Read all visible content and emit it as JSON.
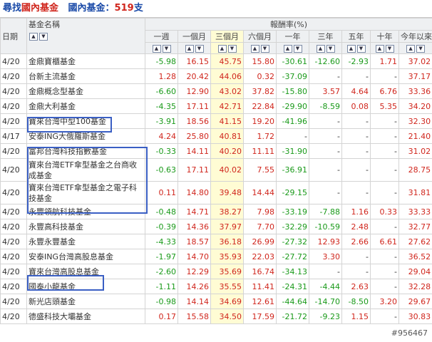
{
  "header": {
    "part1": "尋找",
    "part2": "國內基金",
    "part3": "國內基金：",
    "count": "519",
    "unit": "支"
  },
  "columns": {
    "date": "日期",
    "name": "基金名稱",
    "group": "報酬率(%)",
    "periods": [
      "一週",
      "一個月",
      "三個月",
      "六個月",
      "一年",
      "三年",
      "五年",
      "十年",
      "今年以來"
    ]
  },
  "rows": [
    {
      "date": "4/20",
      "name": "金鼎寶櫃基金",
      "v": [
        "-5.98",
        "16.15",
        "45.75",
        "15.80",
        "-30.61",
        "-12.60",
        "-2.93",
        "1.71",
        "37.02"
      ]
    },
    {
      "date": "4/20",
      "name": "台新主流基金",
      "v": [
        "1.28",
        "20.42",
        "44.06",
        "0.32",
        "-37.09",
        "-",
        "-",
        "-",
        "37.17"
      ]
    },
    {
      "date": "4/20",
      "name": "金鼎概念型基金",
      "v": [
        "-6.60",
        "12.90",
        "43.02",
        "37.82",
        "-15.80",
        "3.57",
        "4.64",
        "6.76",
        "33.36"
      ]
    },
    {
      "date": "4/20",
      "name": "金鼎大利基金",
      "v": [
        "-4.35",
        "17.11",
        "42.71",
        "22.84",
        "-29.90",
        "-8.59",
        "0.08",
        "5.35",
        "34.20"
      ]
    },
    {
      "date": "4/20",
      "name": "寶來台灣中型100基金",
      "v": [
        "-3.91",
        "18.56",
        "41.15",
        "19.20",
        "-41.96",
        "-",
        "-",
        "-",
        "32.30"
      ]
    },
    {
      "date": "4/17",
      "name": "安泰ING大俄羅斯基金",
      "v": [
        "4.24",
        "25.80",
        "40.81",
        "1.72",
        "-",
        "-",
        "-",
        "-",
        "21.40"
      ]
    },
    {
      "date": "4/20",
      "name": "富邦台灣科技指數基金",
      "v": [
        "-0.33",
        "14.11",
        "40.20",
        "11.11",
        "-31.90",
        "-",
        "-",
        "-",
        "31.02"
      ]
    },
    {
      "date": "4/20",
      "name": "寶來台灣ETF傘型基金之台商收成基金",
      "v": [
        "-0.63",
        "17.11",
        "40.02",
        "7.55",
        "-36.91",
        "-",
        "-",
        "-",
        "28.75"
      ]
    },
    {
      "date": "4/20",
      "name": "寶來台灣ETF傘型基金之電子科技基金",
      "v": [
        "0.11",
        "14.80",
        "39.48",
        "14.44",
        "-29.15",
        "-",
        "-",
        "-",
        "31.81"
      ]
    },
    {
      "date": "4/20",
      "name": "永豐領航科技基金",
      "v": [
        "-0.48",
        "14.71",
        "38.27",
        "7.98",
        "-33.19",
        "-7.88",
        "1.16",
        "0.33",
        "33.33"
      ]
    },
    {
      "date": "4/20",
      "name": "永豐高科技基金",
      "v": [
        "-0.39",
        "14.36",
        "37.97",
        "7.70",
        "-32.29",
        "-10.59",
        "2.48",
        "-",
        "32.77"
      ]
    },
    {
      "date": "4/20",
      "name": "永豐永豐基金",
      "v": [
        "-4.33",
        "18.57",
        "36.18",
        "26.99",
        "-27.32",
        "12.93",
        "2.66",
        "6.61",
        "27.62"
      ]
    },
    {
      "date": "4/20",
      "name": "安泰ING台灣高股息基金",
      "v": [
        "-1.97",
        "14.70",
        "35.93",
        "22.03",
        "-27.72",
        "3.30",
        "-",
        "-",
        "36.52"
      ]
    },
    {
      "date": "4/20",
      "name": "寶來台灣高股息基金",
      "v": [
        "-2.60",
        "12.29",
        "35.69",
        "16.74",
        "-34.13",
        "-",
        "-",
        "-",
        "29.04"
      ]
    },
    {
      "date": "4/20",
      "name": "國泰小龍基金",
      "v": [
        "-1.11",
        "14.26",
        "35.55",
        "11.41",
        "-24.31",
        "-4.44",
        "2.63",
        "-",
        "32.28"
      ]
    },
    {
      "date": "4/20",
      "name": "新光店頭基金",
      "v": [
        "-0.98",
        "14.14",
        "34.69",
        "12.61",
        "-44.64",
        "-14.70",
        "-8.50",
        "3.20",
        "29.67"
      ]
    },
    {
      "date": "4/20",
      "name": "德盛科技大壩基金",
      "v": [
        "0.17",
        "15.58",
        "34.50",
        "17.59",
        "-21.72",
        "-9.23",
        "1.15",
        "-",
        "30.83"
      ]
    }
  ],
  "watermark": "#956467",
  "colors": {
    "positive": "#d0261d",
    "negative": "#1a9a1a",
    "highlight_col": "#fffcd4",
    "box": "#3a5fc4"
  }
}
